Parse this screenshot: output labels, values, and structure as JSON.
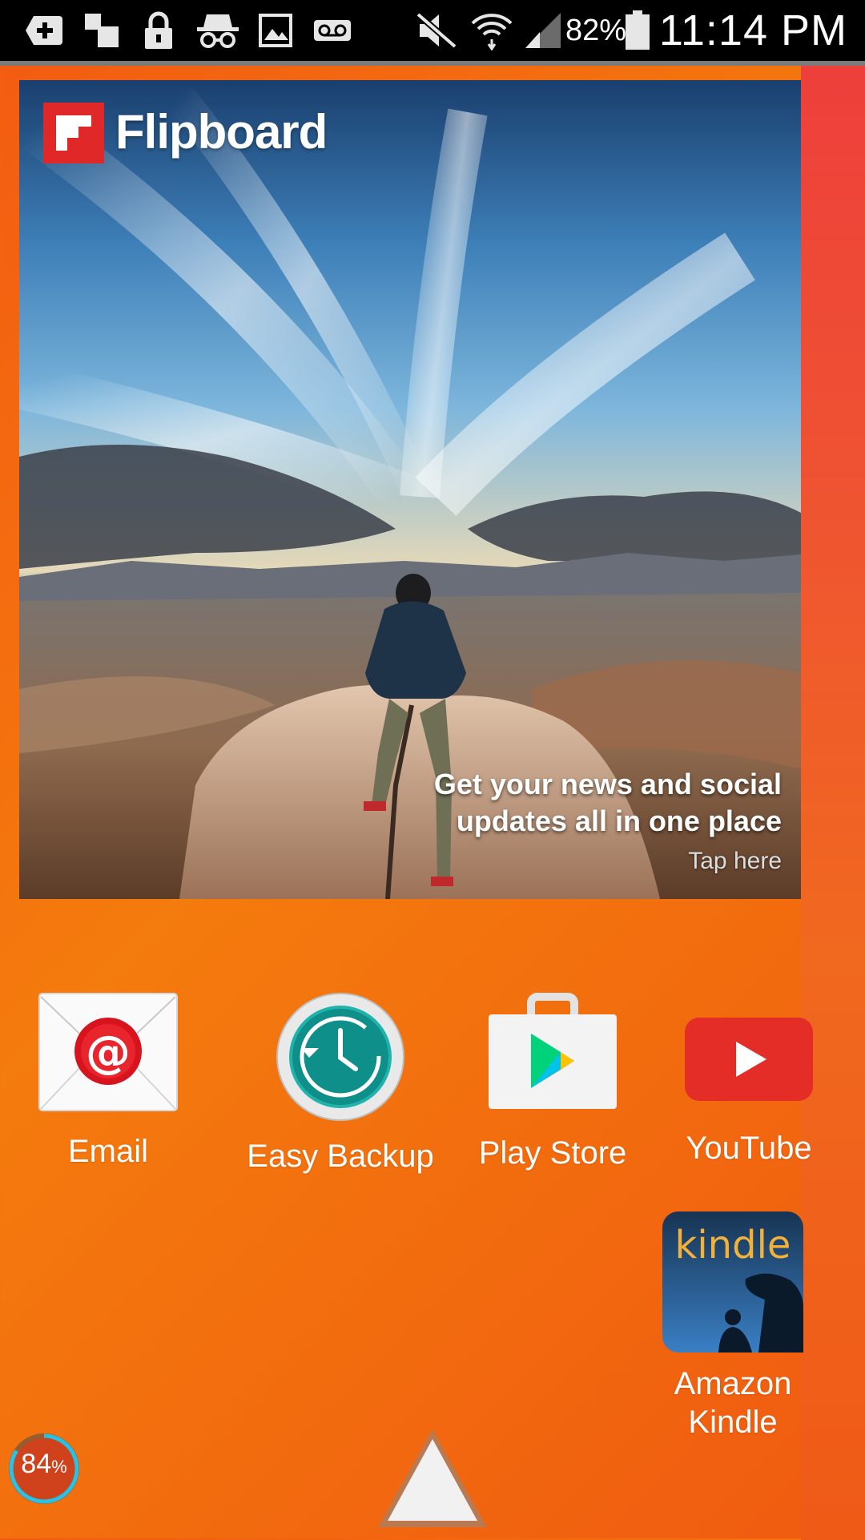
{
  "status_bar": {
    "icons": [
      "add-box-icon",
      "multi-window-icon",
      "lock-icon",
      "incognito-icon",
      "image-icon",
      "voicemail-icon",
      "mute-icon",
      "wifi-icon",
      "signal-icon",
      "battery-icon"
    ],
    "battery_percent": "82%",
    "time": "11:14 PM"
  },
  "flipboard": {
    "brand": "Flipboard",
    "headline_line1": "Get your news and social",
    "headline_line2": "updates all in one place",
    "tap_hint": "Tap here"
  },
  "apps": [
    {
      "label": "Email",
      "icon": "email-icon"
    },
    {
      "label": "Easy Backup",
      "icon": "easy-backup-icon"
    },
    {
      "label": "Play Store",
      "icon": "play-store-icon"
    },
    {
      "label": "YouTube",
      "icon": "youtube-icon"
    },
    {
      "label": "Amazon Kindle",
      "icon": "kindle-icon"
    }
  ],
  "memory_widget": {
    "value": "84",
    "unit": "%"
  },
  "colors": {
    "wallpaper": "#f47b0d",
    "flipboard_red": "#e12828",
    "youtube_red": "#e52d27",
    "backup_teal": "#0f8f8a"
  }
}
